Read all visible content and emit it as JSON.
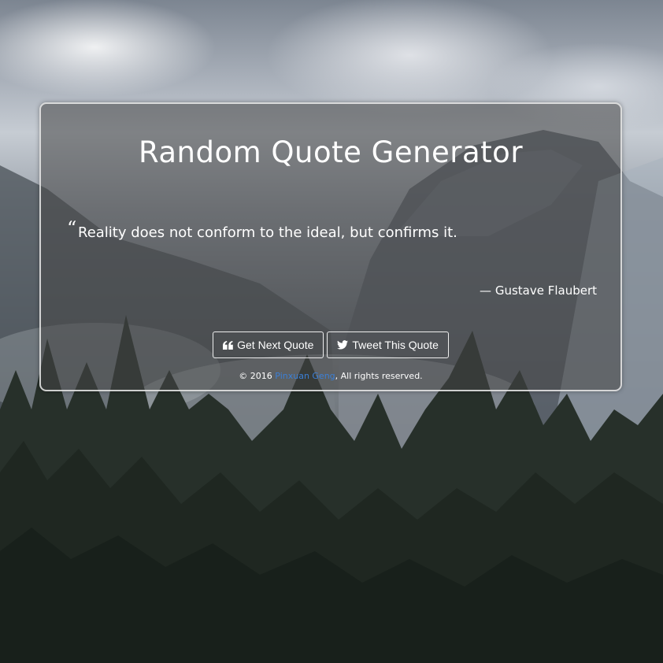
{
  "app": {
    "title": "Random Quote Generator"
  },
  "quote": {
    "mark": "“",
    "text": "Reality does not conform to the ideal, but confirms it.",
    "author": "— Gustave Flaubert"
  },
  "buttons": {
    "next_label": "Get Next Quote",
    "next_icon": "quote-left-icon",
    "tweet_label": "Tweet This Quote",
    "tweet_icon": "twitter-icon"
  },
  "footer": {
    "prefix": "© 2016 ",
    "author_link": "Pinxuan Geng",
    "suffix": ", All rights reserved."
  },
  "colors": {
    "link": "#3b7fd6",
    "text": "#ffffff"
  }
}
